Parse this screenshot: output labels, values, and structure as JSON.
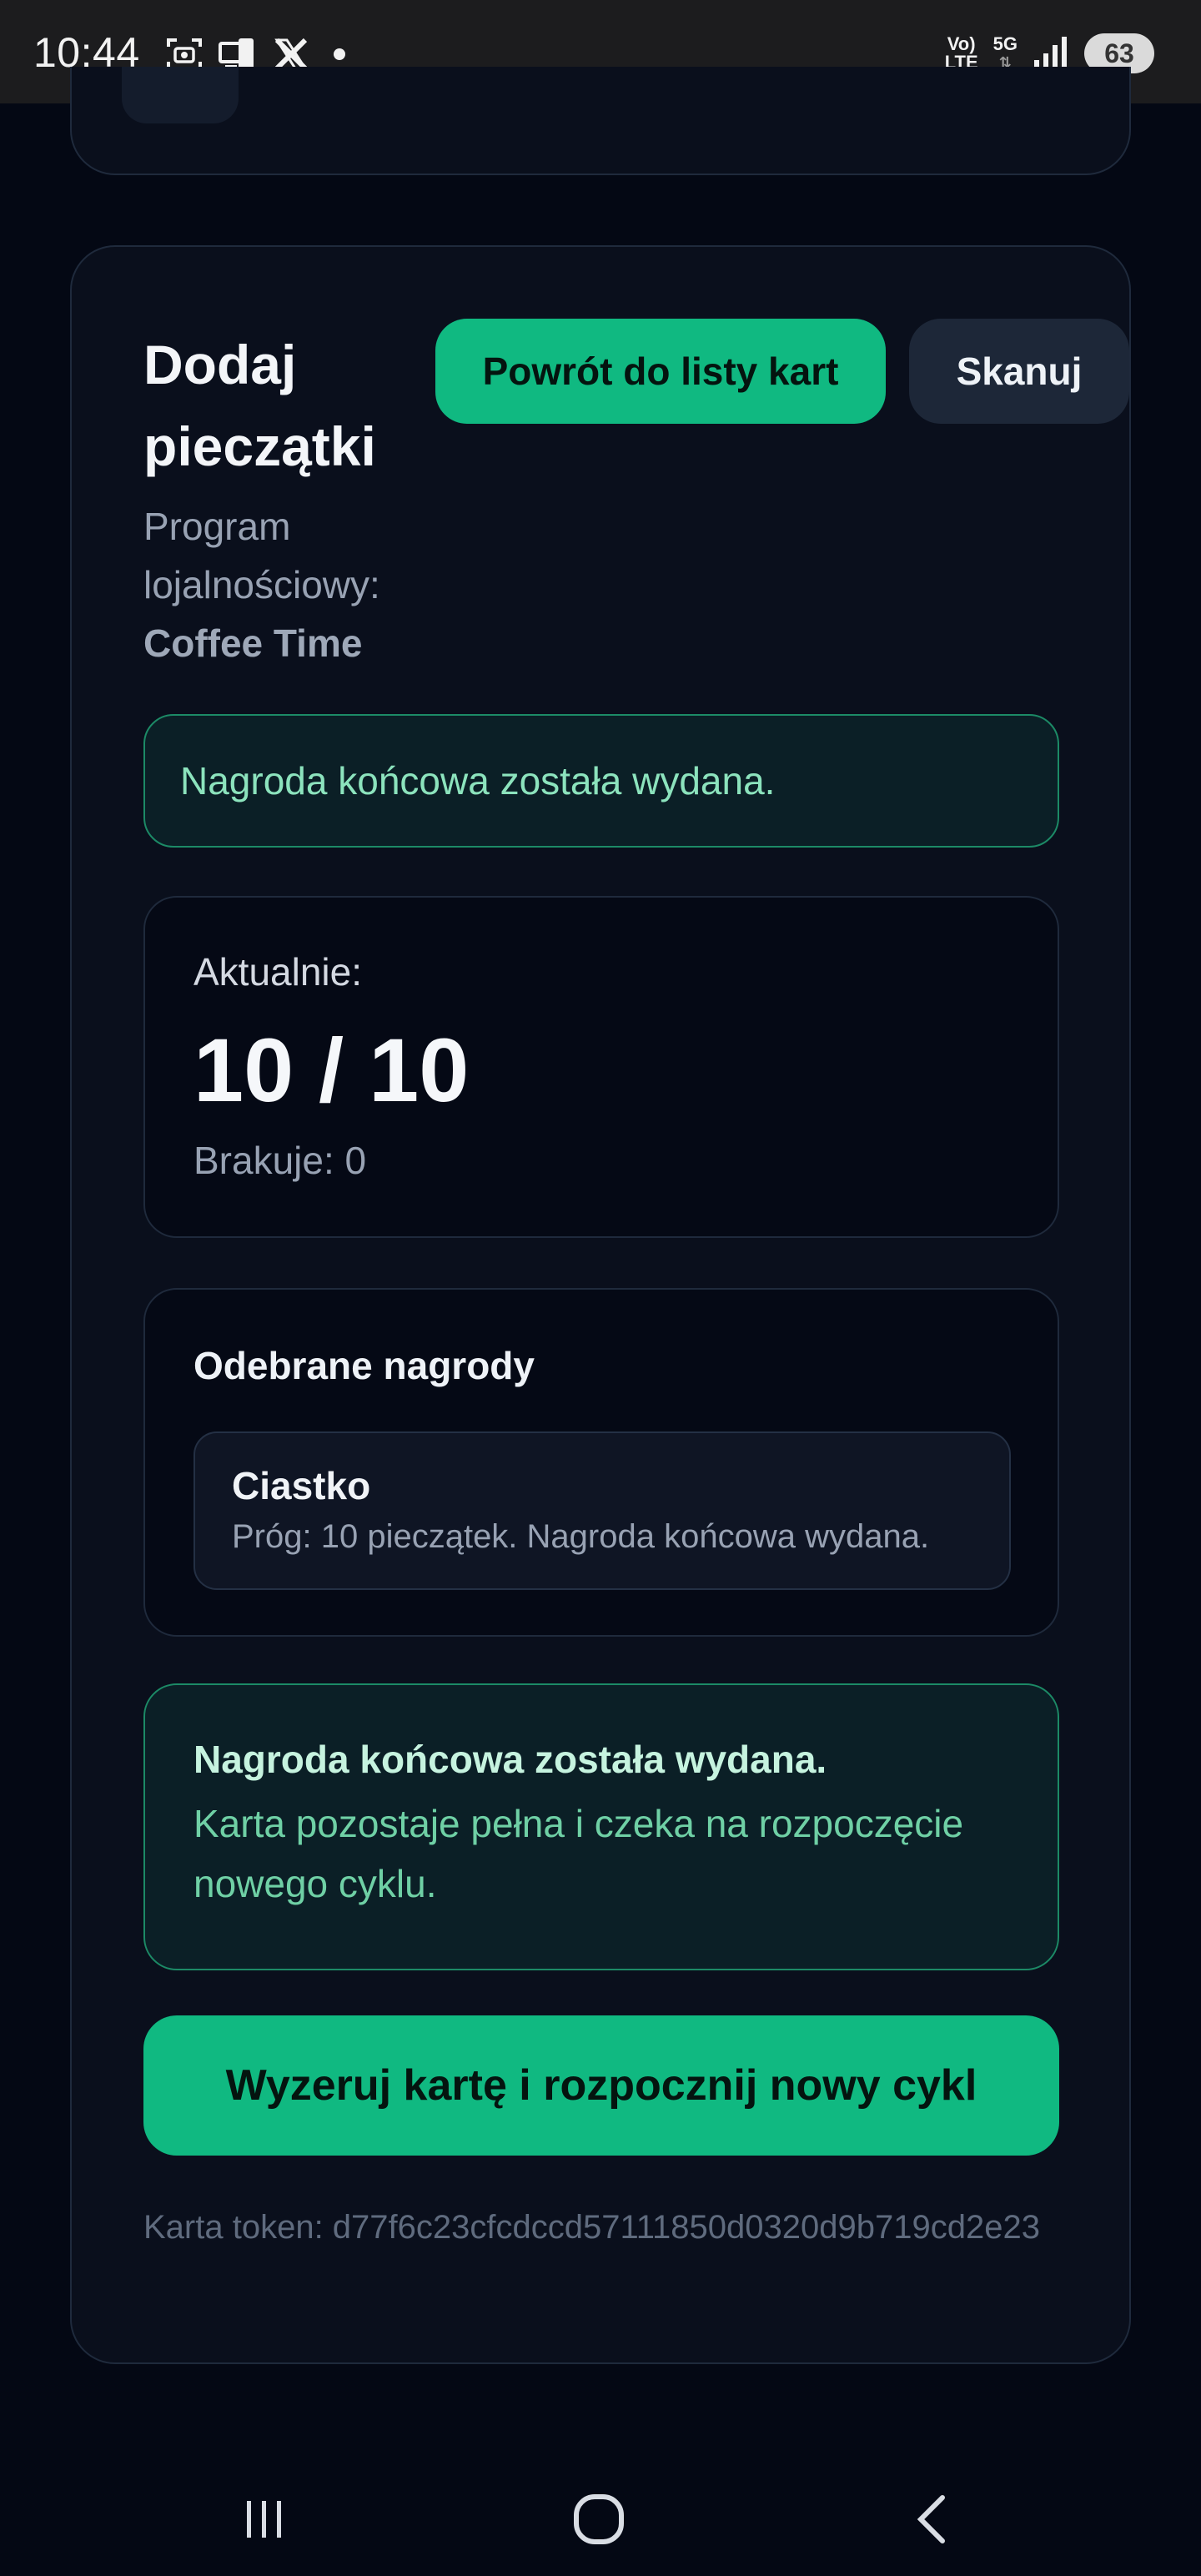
{
  "status_bar": {
    "time": "10:44",
    "network_top": "Vo)",
    "network_bottom": "LTE",
    "signal_label": "5G",
    "battery": "63"
  },
  "card": {
    "title": "Dodaj pieczątki",
    "back_button_label": "Powrót do listy kart",
    "scan_button_label": "Skanuj",
    "program_label": "Program lojalnościowy:",
    "program_name": "Coffee Time"
  },
  "success_alert": "Nagroda końcowa została wydana.",
  "current": {
    "label": "Aktualnie:",
    "value": "10 / 10",
    "missing": "Brakuje: 0"
  },
  "rewards": {
    "title": "Odebrane nagrody",
    "items": [
      {
        "name": "Ciastko",
        "description": "Próg: 10 pieczątek. Nagroda końcowa wydana."
      }
    ]
  },
  "info_alert": {
    "title": "Nagroda końcowa została wydana.",
    "text": "Karta pozostaje pełna i czeka na rozpoczęcie nowego cyklu."
  },
  "reset_button_label": "Wyzeruj kartę i rozpocznij nowy cykl",
  "token_text": "Karta token: d77f6c23cfcdccd57111850d0320d9b719cd2e23",
  "colors": {
    "background": "#040814",
    "accent": "#10b981",
    "success_border": "#1c8a66"
  }
}
